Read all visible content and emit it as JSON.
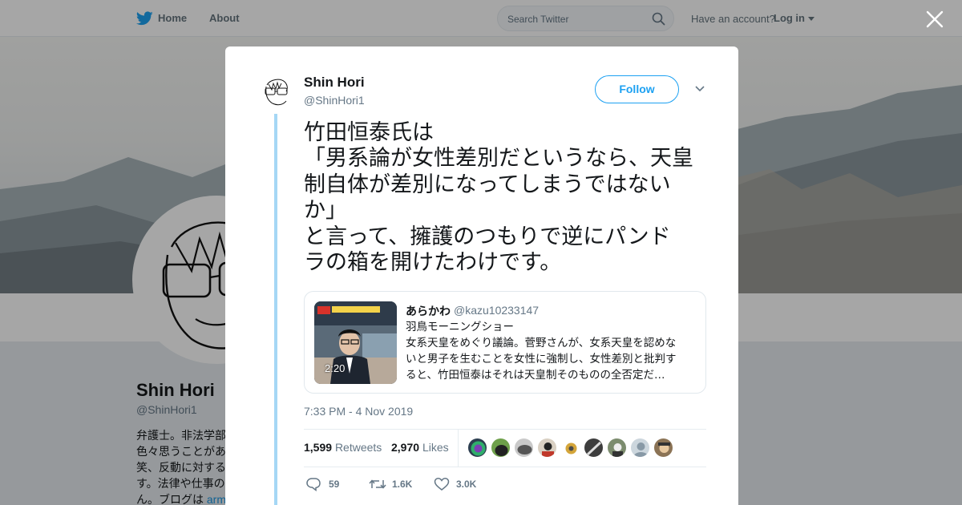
{
  "nav": {
    "home_label": "Home",
    "about_label": "About",
    "search_placeholder": "Search Twitter",
    "have_account": "Have an account?",
    "login_label": "Log in"
  },
  "profile": {
    "name": "Shin Hori",
    "handle": "@ShinHori1",
    "bio_lines": [
      "弁護士。非法学部",
      "色々思うことがあ",
      "笑、反動に対する",
      "す。法律や仕事の",
      "ん。ブログは "
    ],
    "bio_link": "arm"
  },
  "tweet": {
    "author_name": "Shin Hori",
    "author_handle": "@ShinHori1",
    "follow_label": "Follow",
    "text_lines": [
      "竹田恒泰氏は",
      "「男系論が女性差別だというなら、天皇",
      "制自体が差別になってしまうではない",
      "か」",
      "と言って、擁護のつもりで逆にパンド",
      "ラの箱を開けたわけです。"
    ],
    "timestamp": "7:33 PM - 4 Nov 2019",
    "retweets_count": "1,599",
    "retweets_label": "Retweets",
    "likes_count": "2,970",
    "likes_label": "Likes",
    "reply_count": "59",
    "retweet_action_count": "1.6K",
    "like_action_count": "3.0K"
  },
  "quoted": {
    "name": "あらかわ",
    "handle": "@kazu10233147",
    "video_duration": "2:20",
    "text_lines": [
      "羽鳥モーニングショー",
      "女系天皇をめぐり議論。菅野さんが、女系天皇を認めな",
      "いと男子を生むことを女性に強制し、女性差別と批判す",
      "ると、竹田恒泰はそれは天皇制そのものの全否定だ…"
    ]
  },
  "icons": {
    "bird": "twitter-bird-icon",
    "search": "search-icon",
    "close": "close-icon",
    "chevron": "chevron-down-icon",
    "reply": "reply-icon",
    "retweet": "retweet-icon",
    "like": "heart-icon"
  },
  "colors": {
    "brand": "#1da1f2",
    "thread_line": "#a5d7f5",
    "muted": "#657786"
  }
}
